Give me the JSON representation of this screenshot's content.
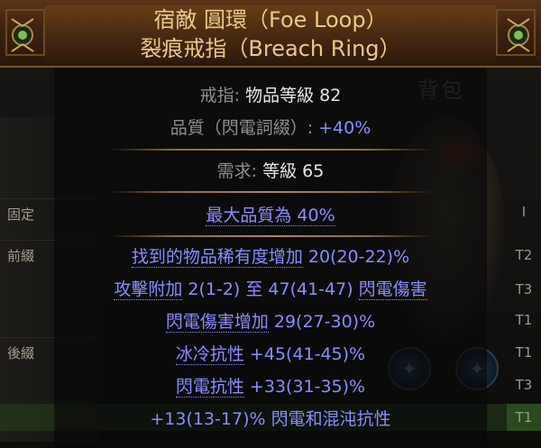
{
  "background": {
    "inventory_title": "背包",
    "side_tabs": [
      "固定",
      "前綴",
      "後綴"
    ],
    "tiers": [
      "I",
      "T2",
      "T3",
      "T1",
      "T1",
      "T3",
      "T1"
    ]
  },
  "item": {
    "name": "宿敵 圓環（Foe Loop）",
    "base_type": "裂痕戒指（Breach Ring）",
    "item_class_label": "戒指: ",
    "item_level": "物品等級 82",
    "quality_label": "品質（閃電詞綴）: ",
    "quality_value": "+40%",
    "requirement_label": "需求: ",
    "requirement_value": "等級 65",
    "implicit": "最大品質為 40%",
    "mods": [
      {
        "a": "找到的物品稀有度增加",
        "b": " 20(20-22)%",
        "tier": "T2"
      },
      {
        "a": "攻擊附加",
        "b": " 2(1-2) 至 47(41-47) ",
        "c": "閃電傷害",
        "tier": "T3"
      },
      {
        "a": "閃電傷害增加",
        "b": " 29(27-30)%",
        "tier": "T1"
      },
      {
        "a": "冰冷抗性",
        "b": " +45(41-45)%",
        "tier": "T1"
      },
      {
        "a": "閃電抗性",
        "b": " +33(31-35)%",
        "tier": "T3"
      },
      {
        "a": "+13(13-17)% 閃電和混沌抗性",
        "tier": "T1"
      }
    ]
  },
  "colors": {
    "unique_name": "#e8c987",
    "magic_mod": "#8b8cff",
    "label_grey": "#8f8f8f"
  }
}
